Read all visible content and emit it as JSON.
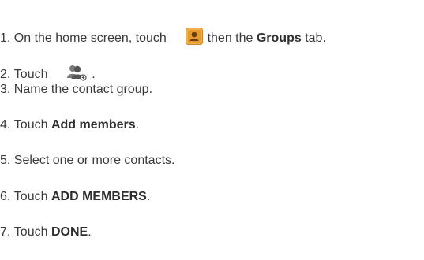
{
  "steps": [
    {
      "number": "1.",
      "text_before": "On the home screen, touch",
      "text_after": "then the",
      "bold": "Groups",
      "text_end": "tab.",
      "icon": "contacts-app-icon"
    },
    {
      "number": "2.",
      "text_before": "Touch",
      "text_end": ".",
      "icon": "add-group-icon"
    },
    {
      "number": "3.",
      "text": "Name the contact group."
    },
    {
      "number": "4.",
      "text_before": "Touch",
      "bold": "Add members",
      "text_end": "."
    },
    {
      "number": "5.",
      "text": "Select one or more contacts."
    },
    {
      "number": "6.",
      "text_before": "Touch",
      "bold": "ADD MEMBERS",
      "text_end": "."
    },
    {
      "number": "7.",
      "text_before": "Touch",
      "bold": "DONE",
      "text_end": "."
    }
  ],
  "colors": {
    "text": "#3a3a3a",
    "contacts_icon": "#e8a23a",
    "group_icon": "#6b6b6b"
  }
}
